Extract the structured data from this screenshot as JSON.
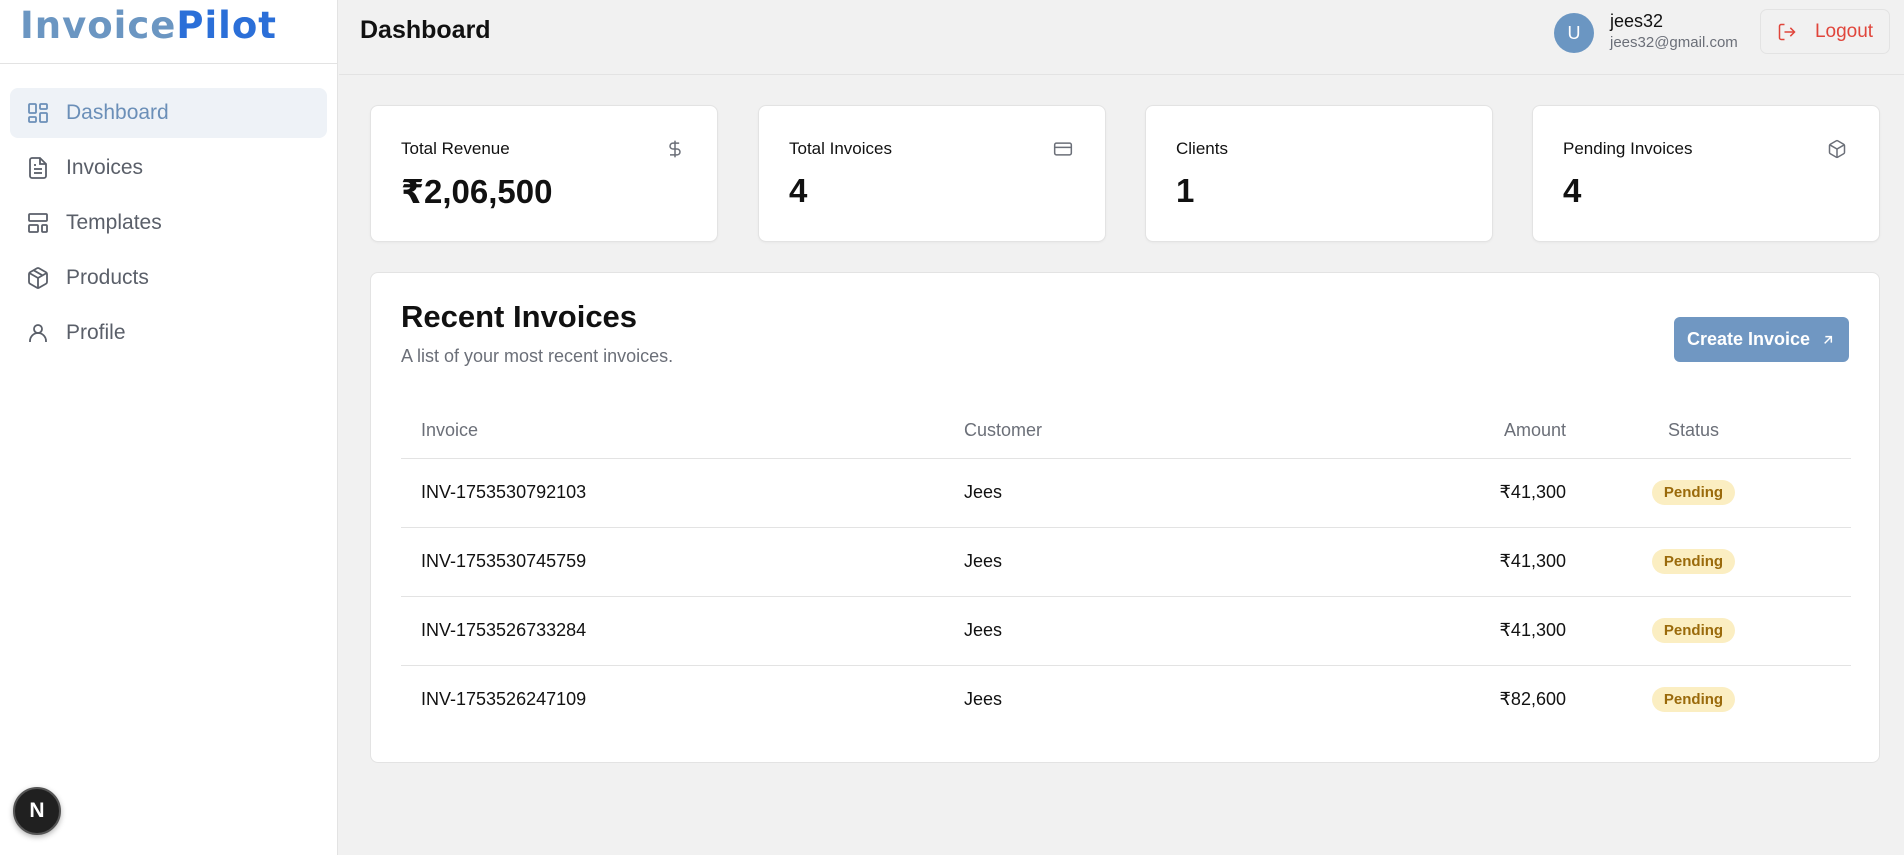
{
  "brand": {
    "part1": "Invoice",
    "part2": "Pilot"
  },
  "sidebar": {
    "items": [
      {
        "label": "Dashboard",
        "icon": "dashboard-icon",
        "active": true
      },
      {
        "label": "Invoices",
        "icon": "file-text-icon"
      },
      {
        "label": "Templates",
        "icon": "layout-template-icon"
      },
      {
        "label": "Products",
        "icon": "package-icon"
      },
      {
        "label": "Profile",
        "icon": "user-icon"
      }
    ],
    "dev_badge": "N"
  },
  "header": {
    "title": "Dashboard",
    "user": {
      "initial": "U",
      "name": "jees32",
      "email": "jees32@gmail.com"
    },
    "logout_label": "Logout"
  },
  "stats": [
    {
      "label": "Total Revenue",
      "value": "₹2,06,500",
      "icon": "dollar-icon"
    },
    {
      "label": "Total Invoices",
      "value": "4",
      "icon": "credit-card-icon"
    },
    {
      "label": "Clients",
      "value": "1"
    },
    {
      "label": "Pending Invoices",
      "value": "4",
      "icon": "package-icon"
    }
  ],
  "recent": {
    "title": "Recent Invoices",
    "subtitle": "A list of your most recent invoices.",
    "create_label": "Create Invoice",
    "columns": [
      "Invoice",
      "Customer",
      "Amount",
      "Status"
    ],
    "rows": [
      {
        "invoice": "INV-1753530792103",
        "customer": "Jees",
        "amount": "₹41,300",
        "status": "Pending"
      },
      {
        "invoice": "INV-1753530745759",
        "customer": "Jees",
        "amount": "₹41,300",
        "status": "Pending"
      },
      {
        "invoice": "INV-1753526733284",
        "customer": "Jees",
        "amount": "₹41,300",
        "status": "Pending"
      },
      {
        "invoice": "INV-1753526247109",
        "customer": "Jees",
        "amount": "₹82,600",
        "status": "Pending"
      }
    ]
  },
  "colors": {
    "accent": "#6b96c2",
    "brand_blue": "#2b6fd8",
    "danger": "#e0453b",
    "pending_bg": "#fbeec2",
    "pending_text": "#9a6a0b"
  }
}
